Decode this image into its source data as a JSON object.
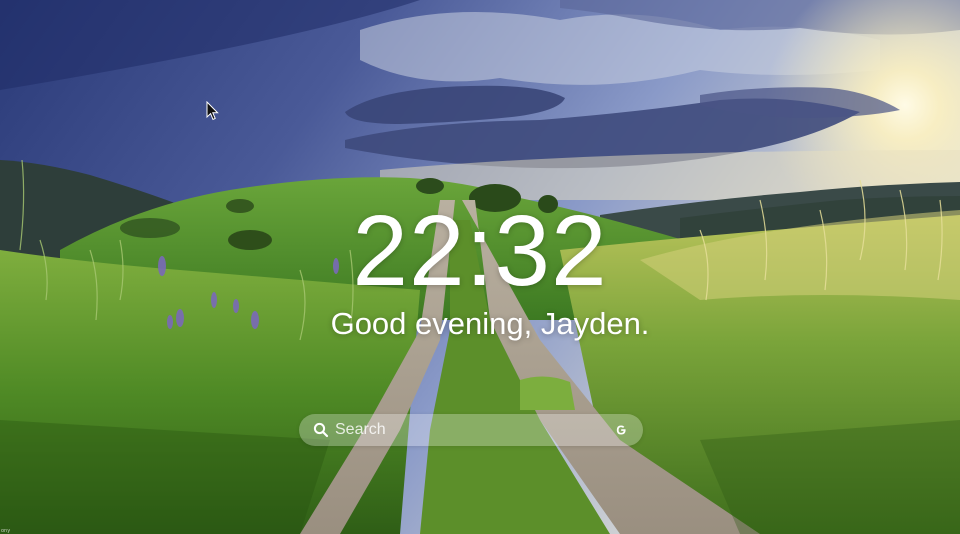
{
  "clock": {
    "time": "22:32"
  },
  "greeting": {
    "text": "Good evening, Jayden."
  },
  "search": {
    "placeholder": "Search",
    "leading_icon": "search-icon",
    "trailing_icon": "google-icon"
  },
  "background": {
    "scene": "grassy-hill-dirt-path-sunset-photo"
  },
  "colors": {
    "text": "#ffffff",
    "search_bg": "rgba(255,255,255,0.28)"
  },
  "corner": {
    "text": "ony"
  }
}
